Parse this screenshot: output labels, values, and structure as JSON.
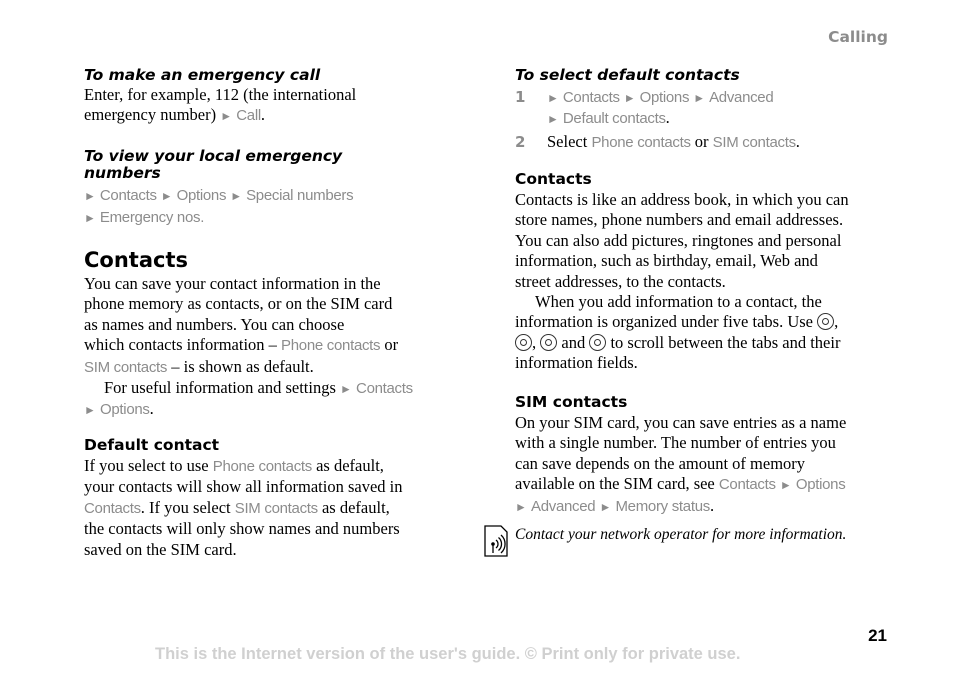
{
  "header": {
    "section": "Calling"
  },
  "left": {
    "emergency_call": {
      "heading": "To make an emergency call",
      "text1": "Enter, for example, 112 (the international",
      "text2": "emergency number)",
      "menu_call": "Call",
      "end": "."
    },
    "local_emergency": {
      "heading_line1": "To view your local emergency",
      "heading_line2": "numbers",
      "path": [
        "Contacts",
        "Options",
        "Special numbers",
        "Emergency nos."
      ]
    },
    "contacts": {
      "heading": "Contacts",
      "l1": "You can save your contact information in the",
      "l2": "phone memory as contacts, or on the SIM card",
      "l3": "as names and numbers. You can choose",
      "l4a": "which contacts information – ",
      "l4_phone": "Phone contacts",
      "l4b": " or",
      "l5_sim": "SIM contacts",
      "l5b": " – is shown as default.",
      "l6a": "For useful information and settings ",
      "l6_contacts": "Contacts",
      "l7_options": "Options",
      "l7_end": "."
    },
    "default_contact": {
      "heading": "Default contact",
      "l1a": "If you select to use ",
      "l1_phone": "Phone contacts",
      "l1b": " as default,",
      "l2": "your contacts will show all information saved in",
      "l3_contacts": "Contacts",
      "l3a": ". If you select ",
      "l3_sim": "SIM contacts",
      "l3b": " as default,",
      "l4": "the contacts will only show names and numbers",
      "l5": "saved on the SIM card."
    }
  },
  "right": {
    "select_default": {
      "heading": "To select default contacts",
      "step1_num": "1",
      "step1_path": [
        "Contacts",
        "Options",
        "Advanced",
        "Default contacts"
      ],
      "step1_end": ".",
      "step2_num": "2",
      "step2_a": "Select ",
      "step2_phone": "Phone contacts",
      "step2_or": " or ",
      "step2_sim": "SIM contacts",
      "step2_end": "."
    },
    "contacts": {
      "heading": "Contacts",
      "l1": "Contacts is like an address book, in which you can",
      "l2": "store names, phone numbers and email addresses.",
      "l3": "You can also add pictures, ringtones and personal",
      "l4": "information, such as birthday, email, Web and",
      "l5": "street addresses, to the contacts.",
      "l6": "When you add information to a contact, the",
      "l7a": "information is organized under five tabs. Use ",
      "l7b": ",",
      "l8a": ",",
      "l8b": " and ",
      "l8c": " to scroll between the tabs and their",
      "l9": "information fields."
    },
    "sim_contacts": {
      "heading": "SIM contacts",
      "l1": "On your SIM card, you can save entries as a name",
      "l2": "with a single number. The number of entries you",
      "l3": "can save depends on the amount of memory",
      "l4a": "available on the SIM card, see ",
      "l4_contacts": "Contacts",
      "l4_options": "Options",
      "l5_advanced": "Advanced",
      "l5_memory": "Memory status",
      "l5_end": "."
    },
    "note": {
      "text": "Contact your network operator for more information."
    }
  },
  "footer": {
    "page_number": "21",
    "notice": "This is the Internet version of the user's guide. © Print only for private use."
  },
  "glyphs": {
    "arrow": "►"
  },
  "colors": {
    "menu_gray": "#8c8c8c",
    "footer_gray": "#d0d0d0"
  }
}
